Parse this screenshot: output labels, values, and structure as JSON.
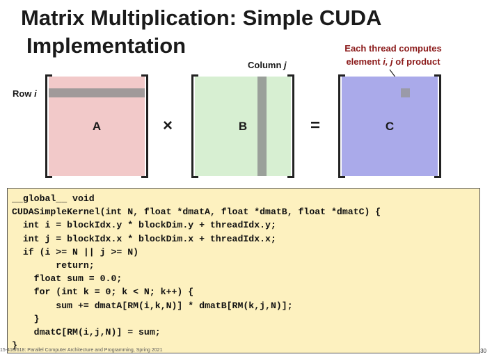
{
  "title": {
    "line1": "Matrix Multiplication: Simple CUDA",
    "line2": "Implementation"
  },
  "labels": {
    "row_prefix": "Row ",
    "row_var": "i",
    "column_prefix": "Column ",
    "column_var": "j"
  },
  "annotation": {
    "line1": "Each thread computes",
    "line2_prefix": "element ",
    "line2_vars": "i, j",
    "line2_suffix": " of product"
  },
  "matrices": {
    "a": "A",
    "b": "B",
    "c": "C",
    "times": "×",
    "equals": "="
  },
  "code": [
    "__global__ void",
    "CUDASimpleKernel(int N, float *dmatA, float *dmatB, float *dmatC) {",
    "  int i = blockIdx.y * blockDim.y + threadIdx.y;",
    "  int j = blockIdx.x * blockDim.x + threadIdx.x;",
    "  if (i >= N || j >= N)",
    "        return;",
    "    float sum = 0.0;",
    "    for (int k = 0; k < N; k++) {",
    "        sum += dmatA[RM(i,k,N)] * dmatB[RM(k,j,N)];",
    "    }",
    "    dmatC[RM(i,j,N)] = sum;",
    "}"
  ],
  "footer": {
    "left": "15-418/618: Parallel Computer Architecture and Programming, Spring 2021",
    "slide_number": "30"
  },
  "colors": {
    "matrix_a": "#f2c9c9",
    "matrix_b": "#d7efd2",
    "matrix_c": "#aaaaea",
    "code_bg": "#fdf1bf",
    "annotation": "#8b1a1a"
  }
}
